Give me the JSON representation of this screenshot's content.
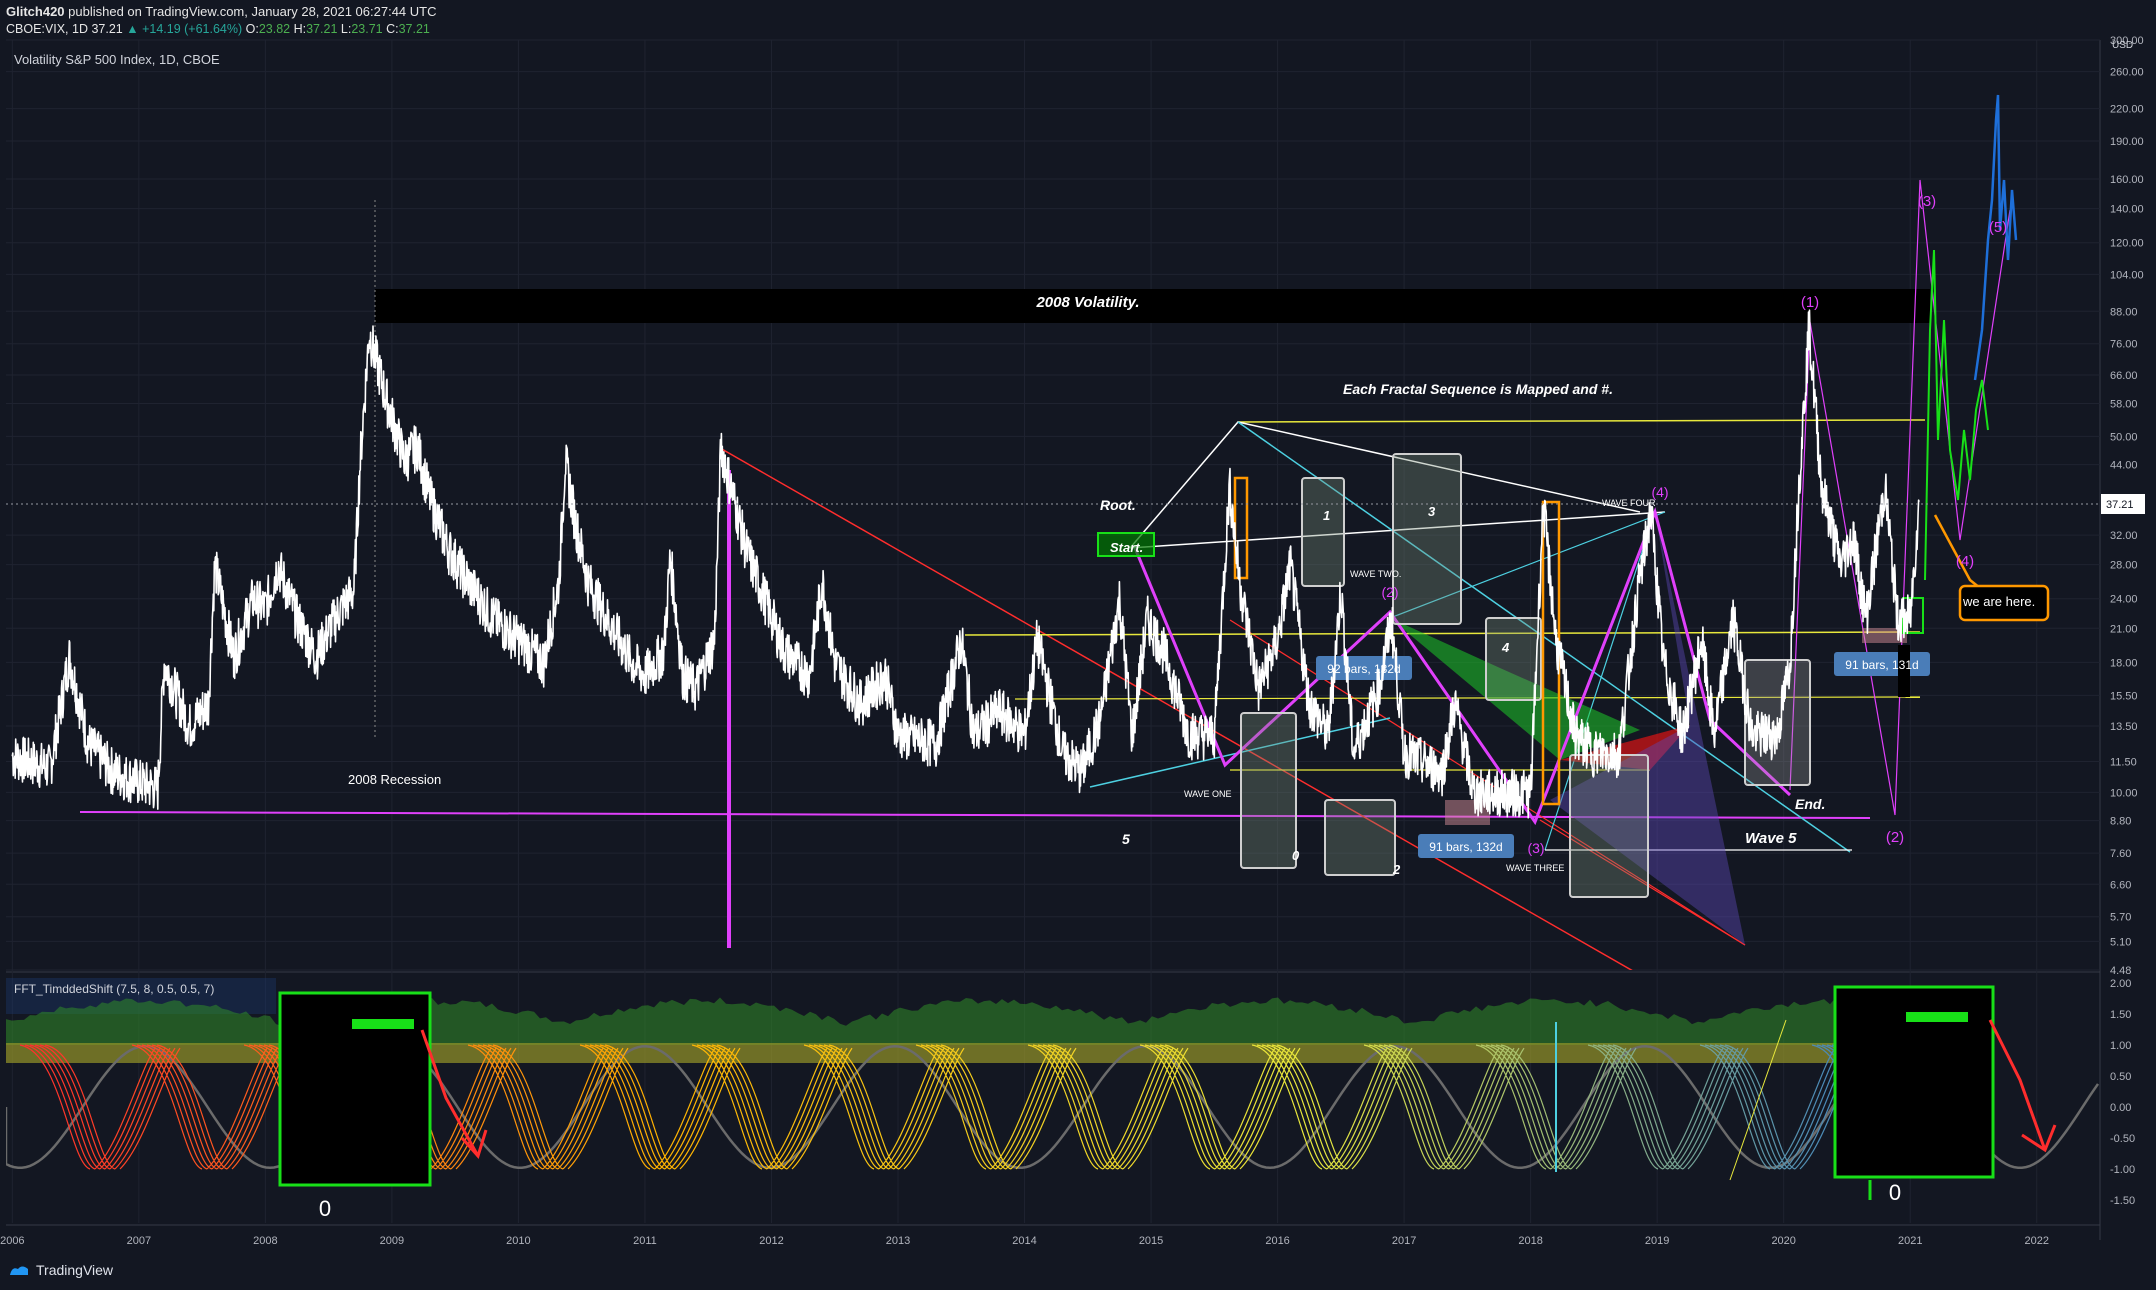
{
  "header": {
    "author": "Glitch420",
    "published": "published on TradingView.com, January 28, 2021 06:27:44 UTC",
    "symbol": "CBOE:VIX, 1D",
    "last": "37.21",
    "change": "▲ +14.19 (+61.64%)",
    "open": "23.82",
    "high": "37.21",
    "low": "23.71",
    "close": "37.21"
  },
  "brand": "TradingView",
  "colors": {
    "background": "#131722",
    "price": "#ffffff",
    "magenta": "#e040fb",
    "yellow": "#e8e83c",
    "cyan": "#4dd0e1",
    "red": "#ff2d2d",
    "green": "#18e018",
    "orange": "#ff9800",
    "blue": "#1e6fd9",
    "label_blue": "#4a7db8"
  },
  "chart_data": {
    "type": "line",
    "title": "Volatility S&P 500 Index, 1D, CBOE",
    "y_unit": "USD",
    "last_price": "37.21",
    "y_scale": "log",
    "ylim": [
      4.48,
      300
    ],
    "y_ticks": [
      "300.00",
      "260.00",
      "220.00",
      "190.00",
      "160.00",
      "140.00",
      "120.00",
      "104.00",
      "88.00",
      "76.00",
      "66.00",
      "58.00",
      "50.00",
      "44.00",
      "37.21",
      "32.00",
      "28.00",
      "24.00",
      "21.00",
      "18.00",
      "15.50",
      "13.50",
      "11.50",
      "10.00",
      "8.80",
      "7.60",
      "6.60",
      "5.70",
      "5.10",
      "4.48"
    ],
    "x_ticks": [
      "2006",
      "2007",
      "2008",
      "2009",
      "2010",
      "2011",
      "2012",
      "2013",
      "2014",
      "2015",
      "2016",
      "2017",
      "2018",
      "2019",
      "2020",
      "2021",
      "2022"
    ],
    "xlim": [
      2005.95,
      2022.5
    ],
    "series": [
      {
        "name": "",
        "points": [
          [
            2006.0,
            11.8
          ],
          [
            2006.3,
            11.2
          ],
          [
            2006.45,
            18.5
          ],
          [
            2006.6,
            12.5
          ],
          [
            2006.8,
            11.0
          ],
          [
            2007.0,
            10.5
          ],
          [
            2007.15,
            10.2
          ],
          [
            2007.2,
            18.0
          ],
          [
            2007.4,
            13.5
          ],
          [
            2007.55,
            15.0
          ],
          [
            2007.6,
            28.0
          ],
          [
            2007.75,
            18.5
          ],
          [
            2007.9,
            24.0
          ],
          [
            2008.0,
            23.0
          ],
          [
            2008.1,
            28.0
          ],
          [
            2008.25,
            22.0
          ],
          [
            2008.4,
            18.5
          ],
          [
            2008.55,
            22.0
          ],
          [
            2008.7,
            25.0
          ],
          [
            2008.75,
            45.0
          ],
          [
            2008.82,
            80.0
          ],
          [
            2008.95,
            60.0
          ],
          [
            2009.1,
            45.0
          ],
          [
            2009.2,
            48.0
          ],
          [
            2009.3,
            38.0
          ],
          [
            2009.45,
            30.0
          ],
          [
            2009.6,
            26.0
          ],
          [
            2009.8,
            22.0
          ],
          [
            2009.9,
            21.0
          ],
          [
            2010.0,
            20.0
          ],
          [
            2010.2,
            18.0
          ],
          [
            2010.32,
            26.0
          ],
          [
            2010.37,
            45.0
          ],
          [
            2010.45,
            34.0
          ],
          [
            2010.55,
            26.0
          ],
          [
            2010.7,
            22.0
          ],
          [
            2010.9,
            18.0
          ],
          [
            2011.0,
            17.0
          ],
          [
            2011.15,
            19.0
          ],
          [
            2011.2,
            29.0
          ],
          [
            2011.3,
            17.0
          ],
          [
            2011.4,
            16.0
          ],
          [
            2011.55,
            20.0
          ],
          [
            2011.6,
            48.0
          ],
          [
            2011.7,
            38.0
          ],
          [
            2011.8,
            30.0
          ],
          [
            2011.95,
            24.0
          ],
          [
            2012.1,
            19.0
          ],
          [
            2012.3,
            17.0
          ],
          [
            2012.4,
            26.0
          ],
          [
            2012.5,
            18.0
          ],
          [
            2012.7,
            15.0
          ],
          [
            2012.9,
            17.0
          ],
          [
            2013.0,
            13.0
          ],
          [
            2013.3,
            12.5
          ],
          [
            2013.5,
            20.0
          ],
          [
            2013.6,
            13.0
          ],
          [
            2013.8,
            14.5
          ],
          [
            2014.0,
            13.0
          ],
          [
            2014.1,
            20.0
          ],
          [
            2014.3,
            12.0
          ],
          [
            2014.45,
            11.0
          ],
          [
            2014.6,
            14.0
          ],
          [
            2014.75,
            24.0
          ],
          [
            2014.85,
            13.0
          ],
          [
            2014.97,
            22.0
          ],
          [
            2015.1,
            19.0
          ],
          [
            2015.3,
            13.0
          ],
          [
            2015.5,
            13.0
          ],
          [
            2015.62,
            40.0
          ],
          [
            2015.7,
            26.0
          ],
          [
            2015.85,
            16.0
          ],
          [
            2016.0,
            20.0
          ],
          [
            2016.1,
            28.0
          ],
          [
            2016.25,
            15.0
          ],
          [
            2016.4,
            13.0
          ],
          [
            2016.5,
            25.0
          ],
          [
            2016.6,
            12.0
          ],
          [
            2016.8,
            16.0
          ],
          [
            2016.9,
            22.0
          ],
          [
            2017.0,
            12.0
          ],
          [
            2017.3,
            11.0
          ],
          [
            2017.4,
            15.0
          ],
          [
            2017.55,
            10.0
          ],
          [
            2017.8,
            10.0
          ],
          [
            2018.0,
            10.0
          ],
          [
            2018.1,
            37.0
          ],
          [
            2018.2,
            20.0
          ],
          [
            2018.35,
            13.0
          ],
          [
            2018.5,
            12.0
          ],
          [
            2018.7,
            12.0
          ],
          [
            2018.85,
            25.0
          ],
          [
            2018.95,
            36.0
          ],
          [
            2019.05,
            18.0
          ],
          [
            2019.2,
            13.0
          ],
          [
            2019.35,
            20.0
          ],
          [
            2019.45,
            13.0
          ],
          [
            2019.6,
            22.0
          ],
          [
            2019.75,
            13.0
          ],
          [
            2019.95,
            13.0
          ],
          [
            2020.05,
            18.0
          ],
          [
            2020.12,
            40.0
          ],
          [
            2020.2,
            82.0
          ],
          [
            2020.3,
            40.0
          ],
          [
            2020.45,
            28.0
          ],
          [
            2020.55,
            32.0
          ],
          [
            2020.65,
            22.0
          ],
          [
            2020.8,
            40.0
          ],
          [
            2020.9,
            22.0
          ],
          [
            2021.0,
            22.0
          ],
          [
            2021.07,
            37.21
          ]
        ]
      }
    ],
    "annotations": {
      "banner": "2008 Volatility.",
      "subtitle": "Each Fractal Sequence is Mapped and #.",
      "recession": "2008 Recession",
      "root": "Root.",
      "start": "Start.",
      "end": "End.",
      "wave5": "Wave 5",
      "we_are_here": "we are here.",
      "wave_one": "WAVE ONE",
      "wave_two": "WAVE TWO.",
      "wave_three": "WAVE THREE",
      "wave_four": "WAVE FOUR",
      "box_1": "1",
      "box_2": "2",
      "box_3": "3",
      "box_4": "4",
      "box_0": "0",
      "five": "5",
      "bars_a": "92 bars, 132d",
      "bars_b": "91 bars, 132d",
      "bars_c": "91 bars, 131d",
      "w1": "(1)",
      "w2": "(2)",
      "w3": "(3)",
      "w4": "(4)",
      "w5": "(5)",
      "w2_old": "(2)",
      "w3_old": "(3)",
      "w4_old": "(4)"
    }
  },
  "indicator": {
    "name": "FFT_TimddedShift (7.5, 8, 0.5, 0.5, 7)",
    "y_ticks": [
      "2.00",
      "1.50",
      "1.00",
      "0.50",
      "0.00",
      "-0.50",
      "-1.00",
      "-1.50"
    ],
    "zero_left": "0",
    "zero_right": "0"
  }
}
